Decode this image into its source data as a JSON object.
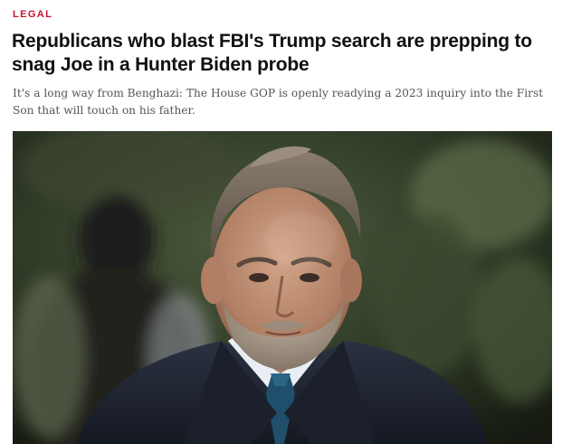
{
  "article": {
    "section": "LEGAL",
    "headline": "Republicans who blast FBI's Trump search are prepping to snag Joe in a Hunter Biden probe",
    "dek": "It's a long way from Benghazi: The House GOP is openly readying a 2023 inquiry into the First Son that will touch on his father."
  },
  "colors": {
    "section_accent": "#c8102e",
    "headline_text": "#111111",
    "dek_text": "#555555"
  }
}
